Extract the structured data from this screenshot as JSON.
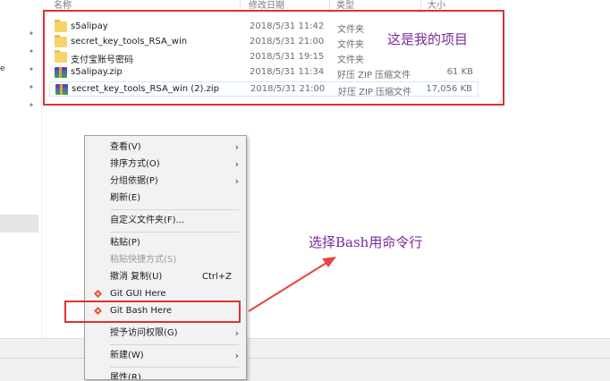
{
  "header": {
    "col_name": "名称",
    "col_date": "修改日期",
    "col_type": "类型",
    "col_size": "大小"
  },
  "files": [
    {
      "name": "s5alipay",
      "date": "2018/5/31 11:42",
      "type": "文件夹",
      "size": "",
      "icon": "folder-icon"
    },
    {
      "name": "secret_key_tools_RSA_win",
      "date": "2018/5/31 21:00",
      "type": "文件夹",
      "size": "",
      "icon": "folder-icon"
    },
    {
      "name": "支付宝账号密码",
      "date": "2018/5/31 19:15",
      "type": "文件夹",
      "size": "",
      "icon": "folder-icon"
    },
    {
      "name": "s5alipay.zip",
      "date": "2018/5/31 11:34",
      "type": "好压 ZIP 压缩文件",
      "size": "61 KB",
      "icon": "zip-archive-icon"
    },
    {
      "name": "secret_key_tools_RSA_win (2).zip",
      "date": "2018/5/31 21:00",
      "type": "好压 ZIP 压缩文件",
      "size": "17,056 KB",
      "icon": "zip-archive-icon"
    }
  ],
  "left_pane": {
    "fragment": "e"
  },
  "annotations": {
    "project_label": "这是我的项目",
    "bash_label": "选择Bash用命令行"
  },
  "context_menu": {
    "view": "查看(V)",
    "sort": "排序方式(O)",
    "group": "分组依据(P)",
    "refresh": "刷新(E)",
    "customize": "自定义文件夹(F)...",
    "paste": "粘贴(P)",
    "paste_shortcut": "粘贴快捷方式(S)",
    "undo": "撤消 复制(U)",
    "undo_shortcut": "Ctrl+Z",
    "git_gui": "Git GUI Here",
    "git_bash": "Git Bash Here",
    "grant_access": "授予访问权限(G)",
    "new": "新建(W)",
    "properties": "属性(R)"
  },
  "colors": {
    "highlight_red": "#e03131",
    "annotation_purple": "#7a2a9a",
    "arrow_red": "#e8453c"
  }
}
